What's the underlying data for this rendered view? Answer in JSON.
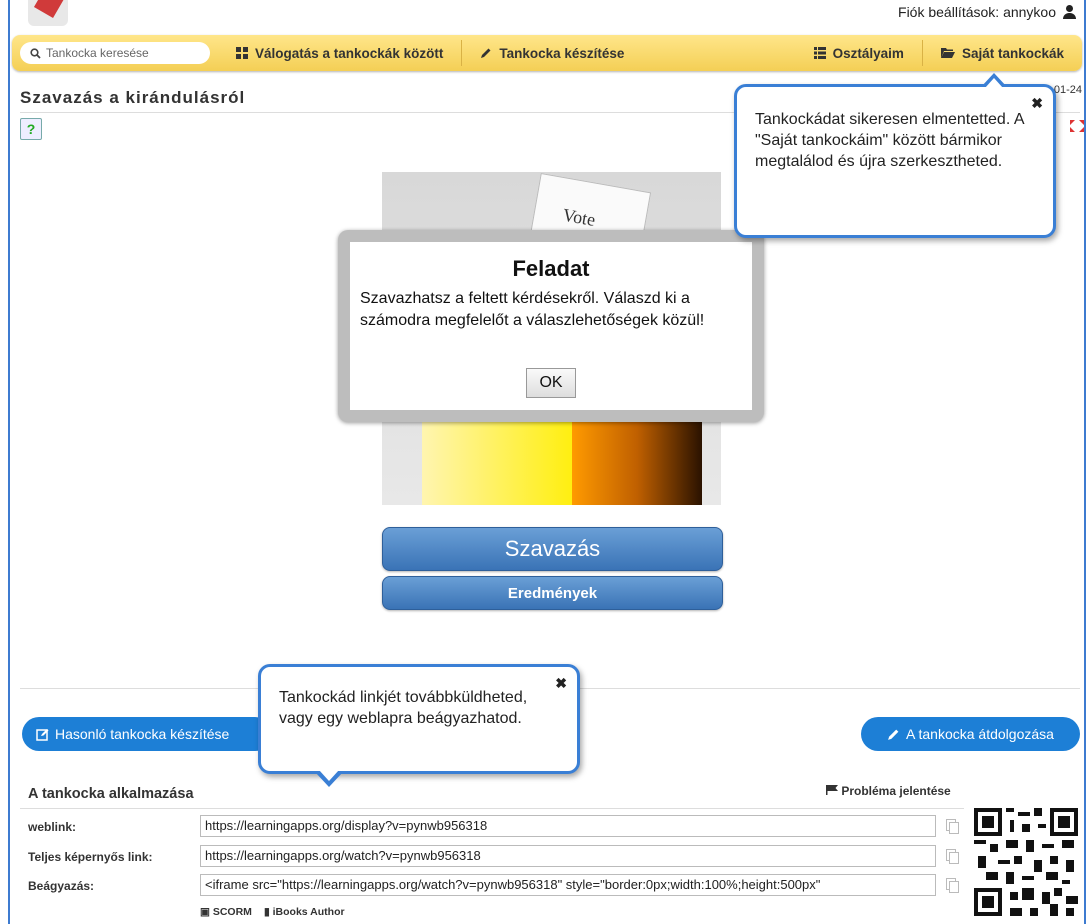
{
  "header": {
    "account_label": "Fiók beállítások: annykoo"
  },
  "nav": {
    "search_placeholder": "Tankocka keresése",
    "items": [
      {
        "label": "Válogatás a tankockák között",
        "icon": "grid-icon"
      },
      {
        "label": "Tankocka készítése",
        "icon": "pencil-icon"
      },
      {
        "label": "Osztályaim",
        "icon": "list-icon"
      },
      {
        "label": "Saját tankockák",
        "icon": "folder-icon"
      }
    ]
  },
  "page": {
    "title": "Szavazás a kirándulásról",
    "date_fragment": "01-24"
  },
  "app": {
    "image_text": "Vote",
    "dialog_title": "Feladat",
    "dialog_text": "Szavazhatsz a feltett kérdésekről. Válaszd ki a számodra megfelelőt a válaszlehetőségek közül!",
    "ok_label": "OK",
    "vote_label": "Szavazás",
    "results_label": "Eredmények"
  },
  "actions": {
    "similar_label": "Hasonló tankocka készítése",
    "rework_label": "A tankocka átdolgozása"
  },
  "usage": {
    "title": "A tankocka alkalmazása",
    "problem_label": "Probléma jelentése",
    "rows": [
      {
        "label": "weblink:",
        "value": "https://learningapps.org/display?v=pynwb956318"
      },
      {
        "label": "Teljes képernyős link:",
        "value": "https://learningapps.org/watch?v=pynwb956318"
      },
      {
        "label": "Beágyazás:",
        "value": "<iframe src=\"https://learningapps.org/watch?v=pynwb956318\" style=\"border:0px;width:100%;height:500px\""
      }
    ],
    "scorm_label": "SCORM",
    "ibooks_label": "iBooks Author"
  },
  "tooltips": {
    "saved_text": "Tankockádat sikeresen elmentetted. A \"Saját tankockáim\" között bármikor megtalálod és újra szerkesztheted.",
    "link_text": "Tankockád linkjét továbbküldheted, vagy egy weblapra beágyazhatod."
  },
  "colors": {
    "nav_bg": "#f4cf55",
    "accent_blue": "#1d7fd6",
    "tooltip_border": "#3a7fd5"
  }
}
